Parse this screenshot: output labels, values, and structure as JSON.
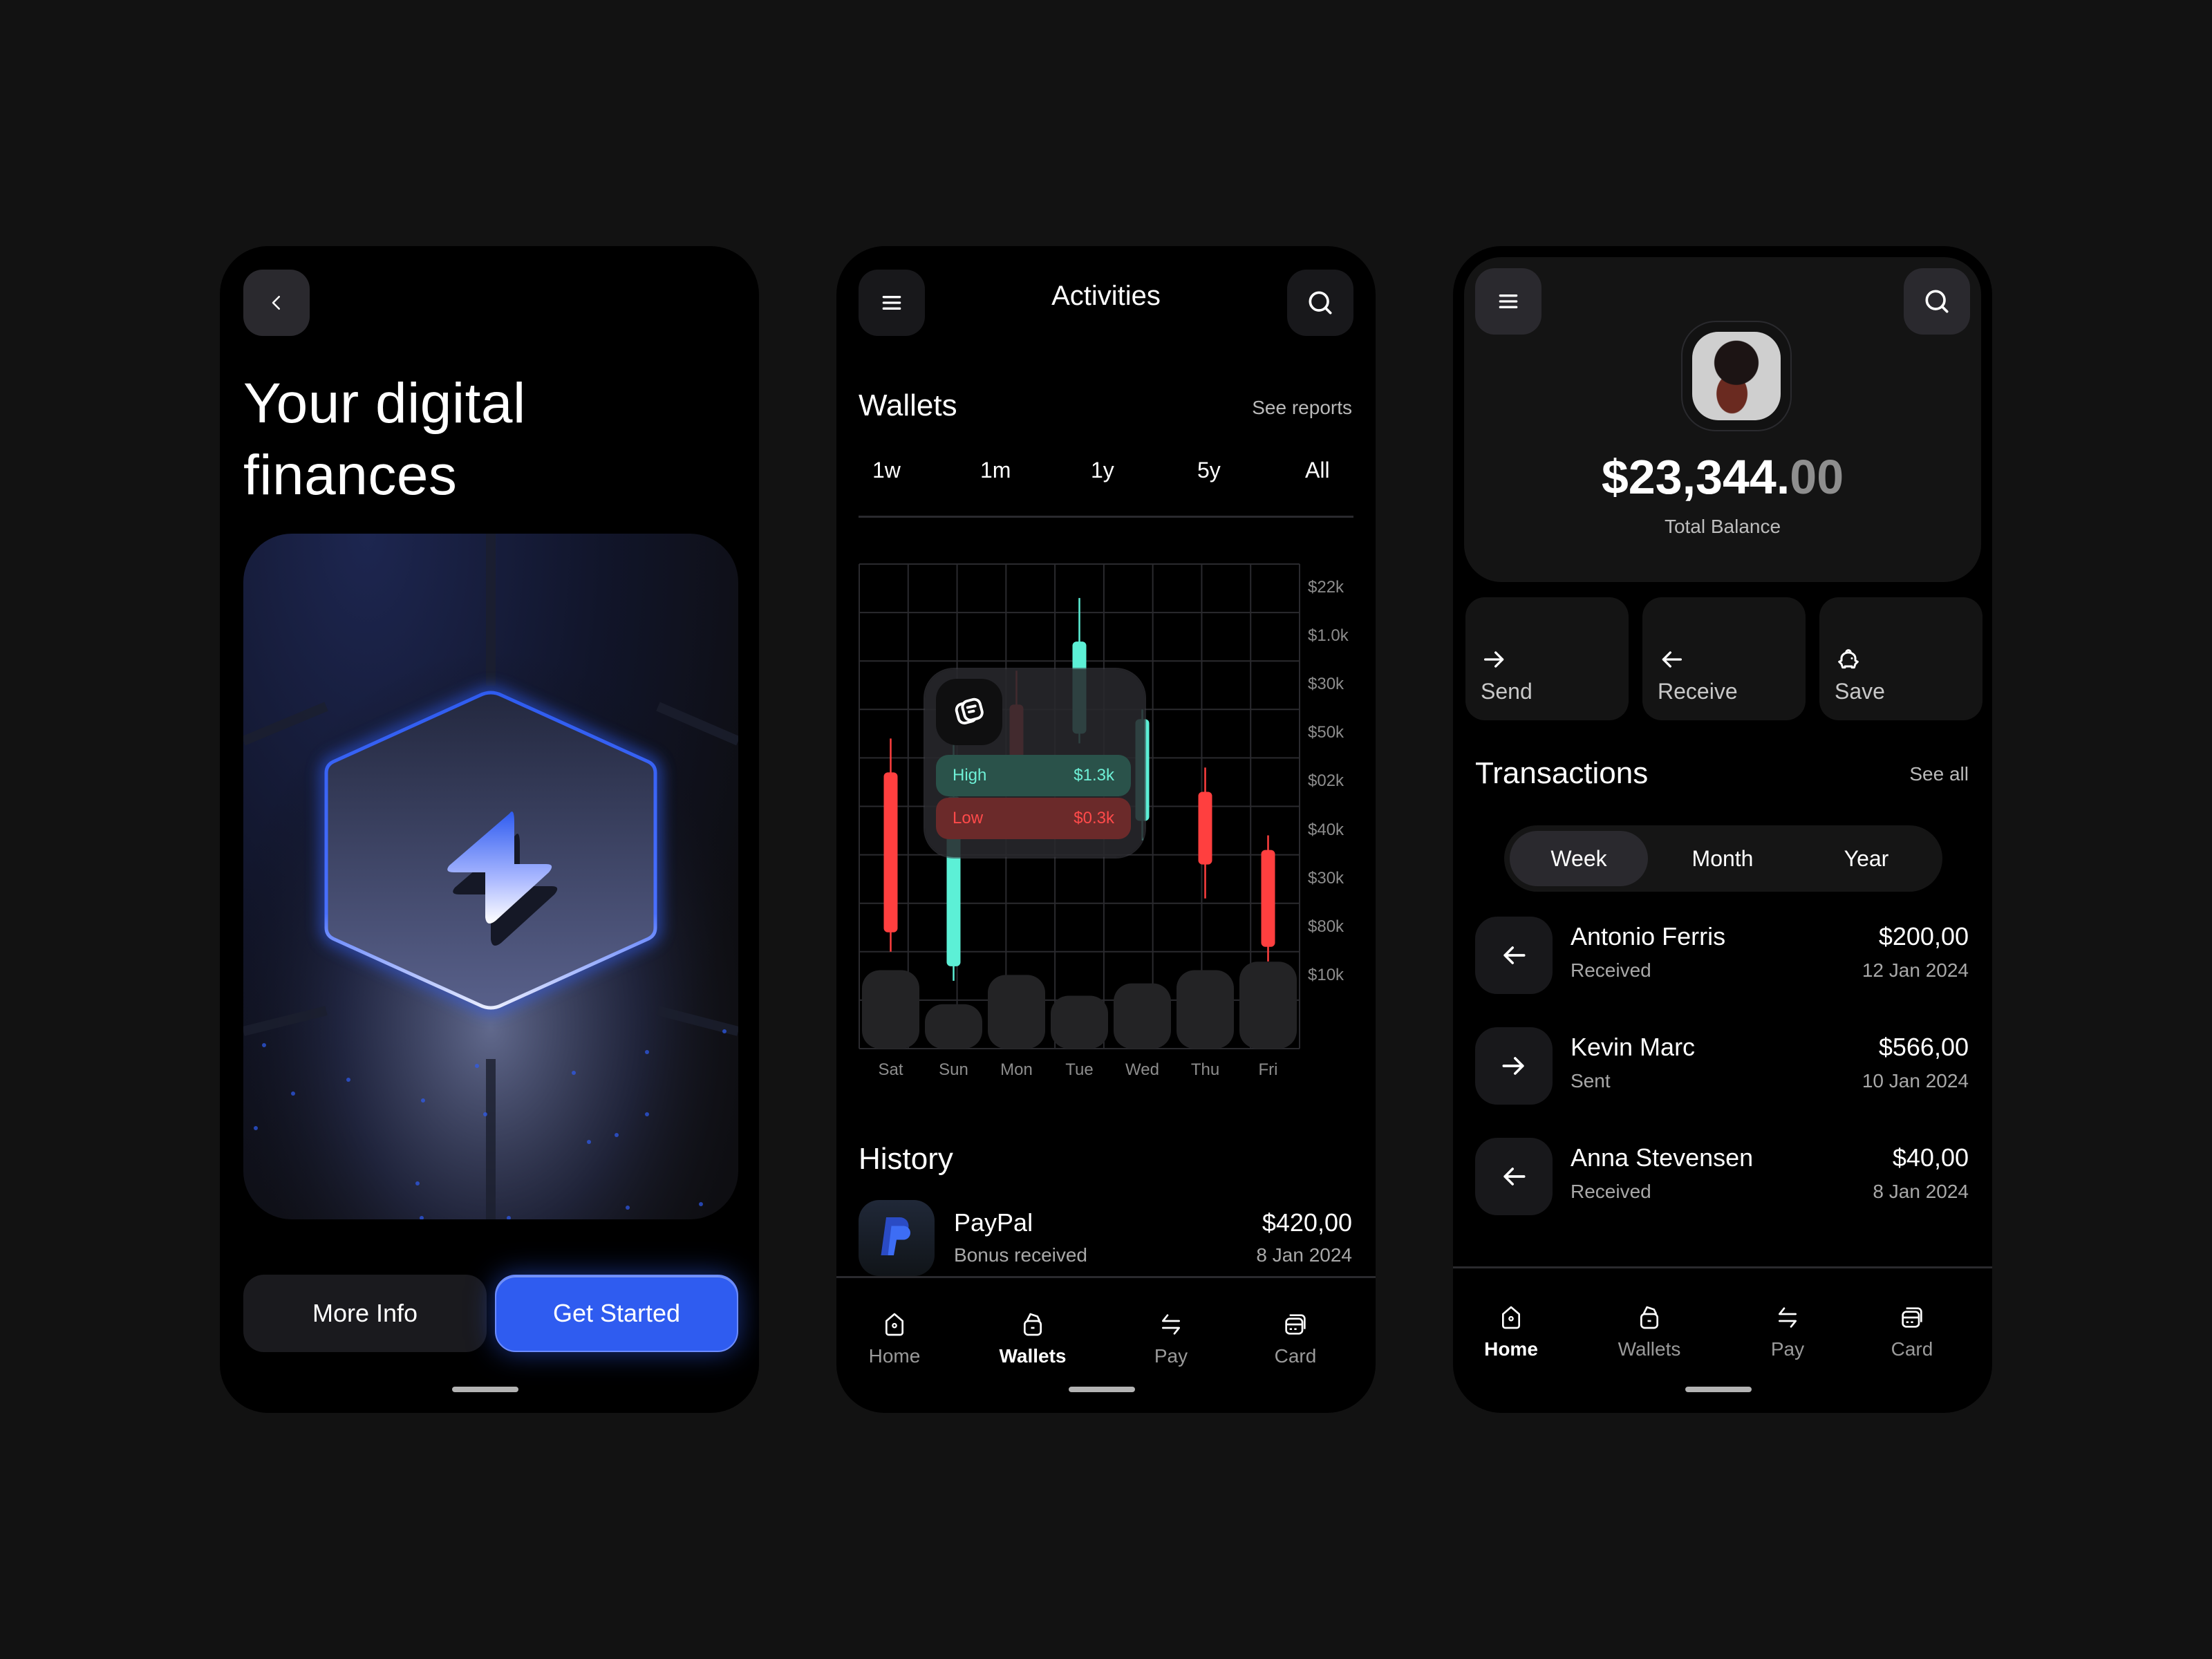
{
  "screen1": {
    "back_icon": "chevron-left-icon",
    "title_line1": "Your digital",
    "title_line2": "finances",
    "hero_icon": "lightning-bolt-icon",
    "more_info": "More Info",
    "get_started": "Get Started"
  },
  "screen2": {
    "menu_icon": "hamburger-menu-icon",
    "title": "Activities",
    "search_icon": "search-icon",
    "wallets_title": "Wallets",
    "see_reports": "See reports",
    "ranges": [
      "1w",
      "1m",
      "1y",
      "5y",
      "All"
    ],
    "tooltip": {
      "icon": "stacked-cards-icon",
      "high_label": "High",
      "high_value": "$1.3k",
      "low_label": "Low",
      "low_value": "$0.3k"
    },
    "history_title": "History",
    "history": [
      {
        "name": "PayPal",
        "sub": "Bonus received",
        "amount": "$420,00",
        "date": "8 Jan 2024",
        "icon": "paypal-icon"
      }
    ],
    "tabs": [
      {
        "label": "Home",
        "icon": "home-icon",
        "active": false
      },
      {
        "label": "Wallets",
        "icon": "wallet-icon",
        "active": true
      },
      {
        "label": "Pay",
        "icon": "transfer-arrows-icon",
        "active": false
      },
      {
        "label": "Card",
        "icon": "card-icon",
        "active": false
      }
    ]
  },
  "chart_data": {
    "type": "candlestick",
    "title": "Wallets",
    "categories": [
      "Sat",
      "Sun",
      "Mon",
      "Tue",
      "Wed",
      "Thu",
      "Fri"
    ],
    "y_tick_labels": [
      "$22k",
      "$1.0k",
      "$30k",
      "$50k",
      "$02k",
      "$40k",
      "$30k",
      "$80k",
      "$10k"
    ],
    "grid": true,
    "candles": [
      {
        "day": "Sat",
        "direction": "down",
        "high": 6.4,
        "open": 5.7,
        "close": 2.4,
        "low": 2.0
      },
      {
        "day": "Sun",
        "direction": "up",
        "high": 7.2,
        "open": 1.7,
        "close": 5.2,
        "low": 1.4
      },
      {
        "day": "Mon",
        "direction": "down",
        "high": 7.8,
        "open": 7.1,
        "close": 6.0,
        "low": 5.6
      },
      {
        "day": "Tue",
        "direction": "up",
        "high": 9.3,
        "open": 6.5,
        "close": 8.4,
        "low": 6.3
      },
      {
        "day": "Wed",
        "direction": "up",
        "high": 7.0,
        "open": 4.7,
        "close": 6.8,
        "low": 4.3
      },
      {
        "day": "Thu",
        "direction": "down",
        "high": 5.8,
        "open": 5.3,
        "close": 3.8,
        "low": 3.1
      },
      {
        "day": "Fri",
        "direction": "down",
        "high": 4.4,
        "open": 4.1,
        "close": 2.1,
        "low": 1.8
      }
    ],
    "volume": [
      0.83,
      0.47,
      0.78,
      0.56,
      0.69,
      0.83,
      0.92
    ],
    "y_range": [
      0,
      10
    ],
    "colors": {
      "up": "#5cf0d6",
      "down": "#ff3f3f",
      "volume": "#232325",
      "grid": "#2a2a2e"
    }
  },
  "screen3": {
    "menu_icon": "hamburger-menu-icon",
    "search_icon": "search-icon",
    "balance_main": "$23,344.",
    "balance_cents": "00",
    "balance_label": "Total Balance",
    "actions": [
      {
        "label": "Send",
        "icon": "arrow-right-icon"
      },
      {
        "label": "Receive",
        "icon": "arrow-left-icon"
      },
      {
        "label": "Save",
        "icon": "piggy-bank-icon"
      }
    ],
    "transactions_title": "Transactions",
    "see_all": "See all",
    "periods": [
      "Week",
      "Month",
      "Year"
    ],
    "active_period": "Week",
    "transactions": [
      {
        "name": "Antonio Ferris",
        "status": "Received",
        "amount": "$200,00",
        "date": "12 Jan 2024",
        "direction": "in"
      },
      {
        "name": "Kevin Marc",
        "status": "Sent",
        "amount": "$566,00",
        "date": "10 Jan 2024",
        "direction": "out"
      },
      {
        "name": "Anna Stevensen",
        "status": "Received",
        "amount": "$40,00",
        "date": "8 Jan 2024",
        "direction": "in"
      }
    ],
    "tabs": [
      {
        "label": "Home",
        "icon": "home-icon",
        "active": true
      },
      {
        "label": "Wallets",
        "icon": "wallet-icon",
        "active": false
      },
      {
        "label": "Pay",
        "icon": "transfer-arrows-icon",
        "active": false
      },
      {
        "label": "Card",
        "icon": "card-icon",
        "active": false
      }
    ]
  },
  "colors": {
    "background": "#121212",
    "phone": "#000000",
    "accent_blue": "#2f5cf0",
    "up_green": "#5cf0d6",
    "down_red": "#ff3f3f"
  }
}
